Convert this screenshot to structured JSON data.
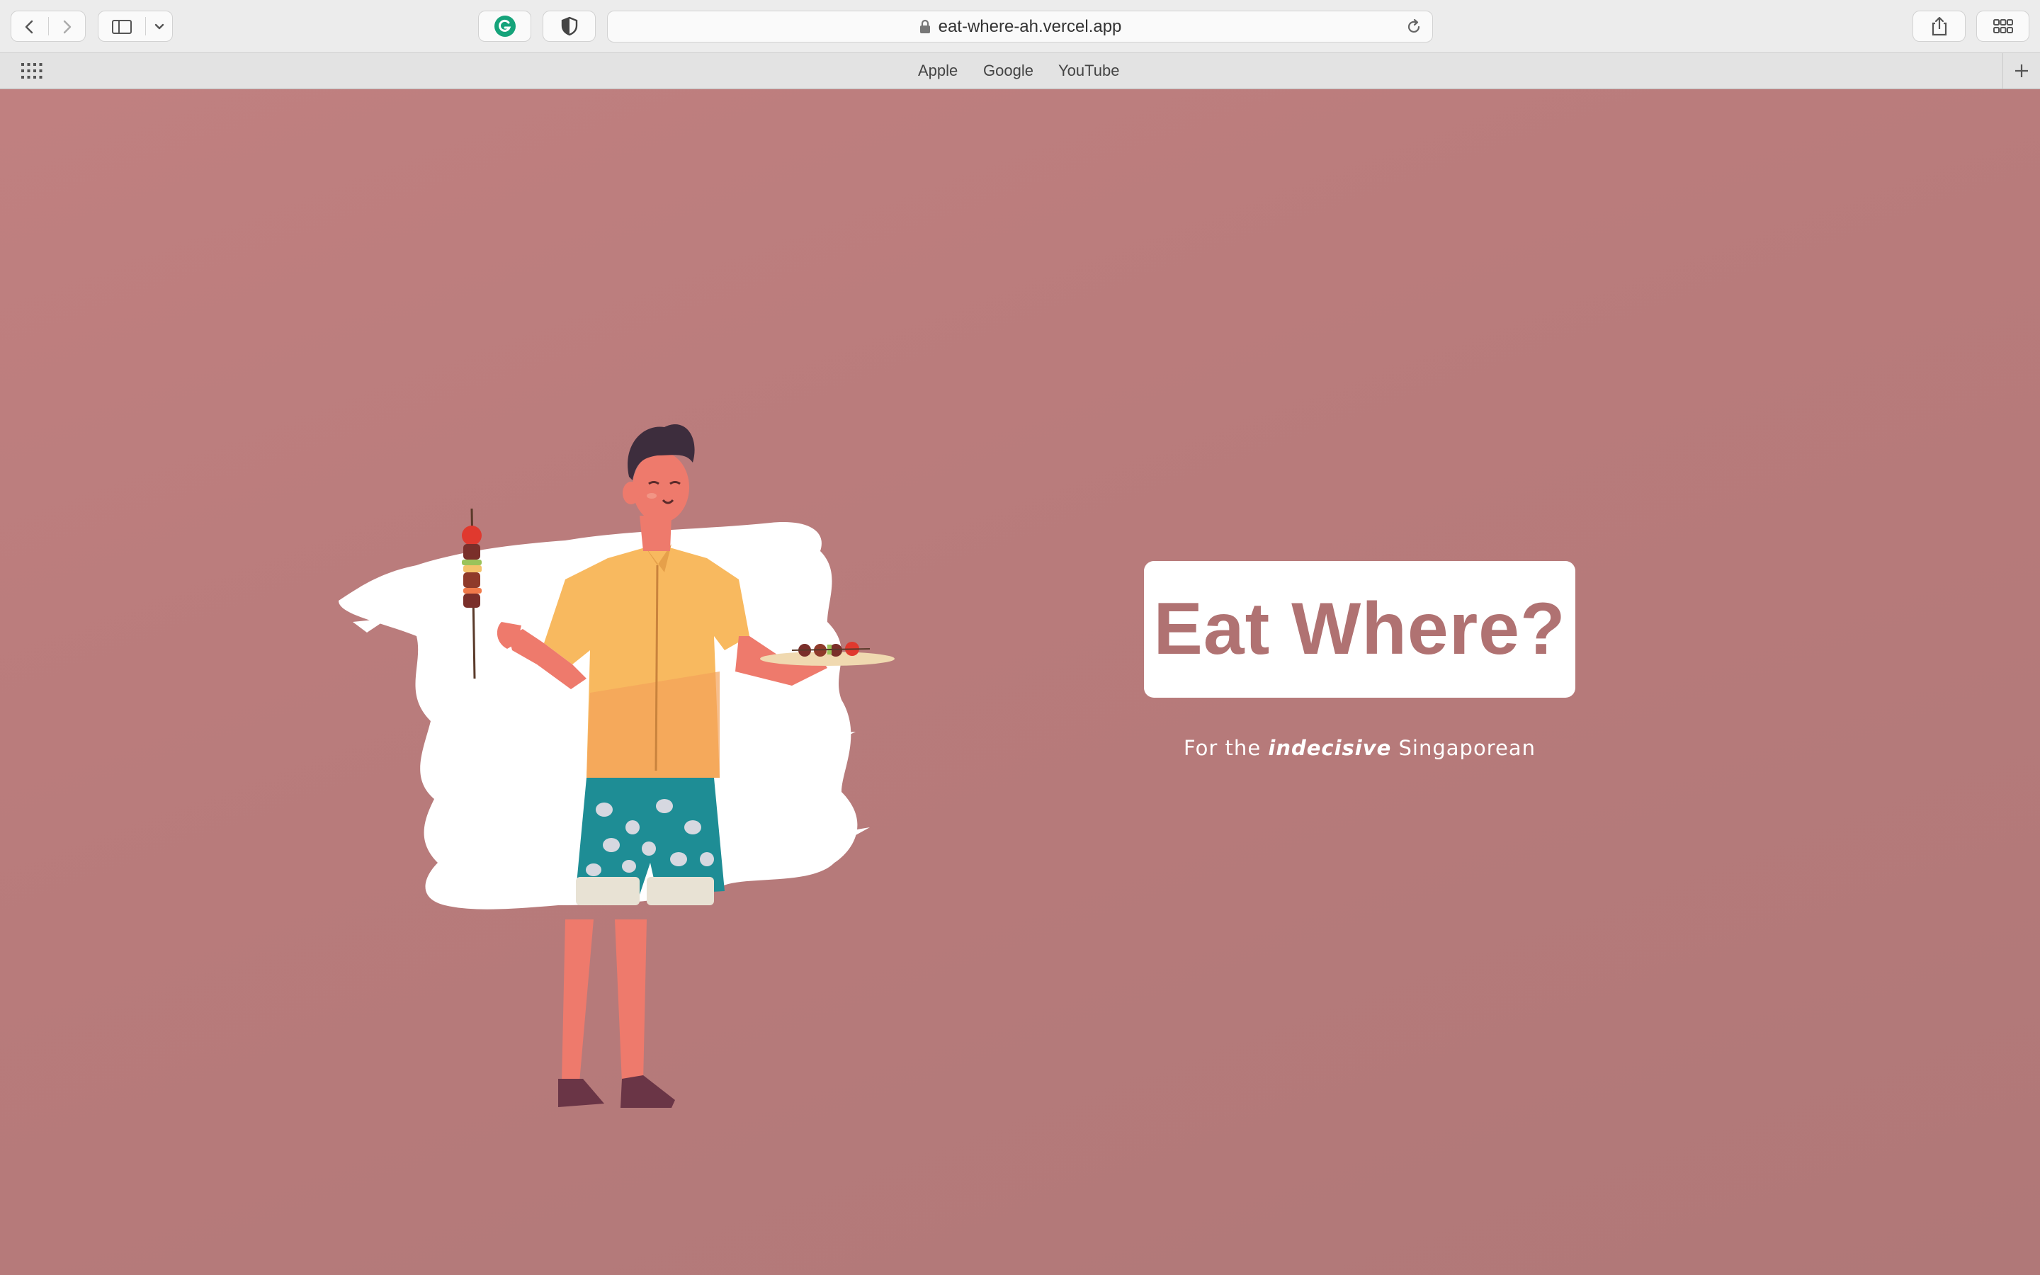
{
  "browser": {
    "url": "eat-where-ah.vercel.app",
    "favorites": [
      "Apple",
      "Google",
      "YouTube"
    ],
    "icons": {
      "back": "chevron-left-icon",
      "forward": "chevron-right-icon",
      "sidebar": "sidebar-icon",
      "sidebar_menu": "chevron-down-icon",
      "grammarly": "grammarly-icon",
      "privacy": "shield-icon",
      "lock": "lock-icon",
      "reload": "reload-icon",
      "share": "share-icon",
      "tabs": "tab-overview-icon",
      "favorites_grid": "grid-icon",
      "new_tab": "plus-icon"
    }
  },
  "page": {
    "title": "Eat Where?",
    "tagline_prefix": "For the ",
    "tagline_emphasis": "indecisive",
    "tagline_suffix": " Singaporean",
    "colors": {
      "background": "#b87b7b",
      "title_text": "#b07272",
      "card": "#ffffff"
    }
  }
}
